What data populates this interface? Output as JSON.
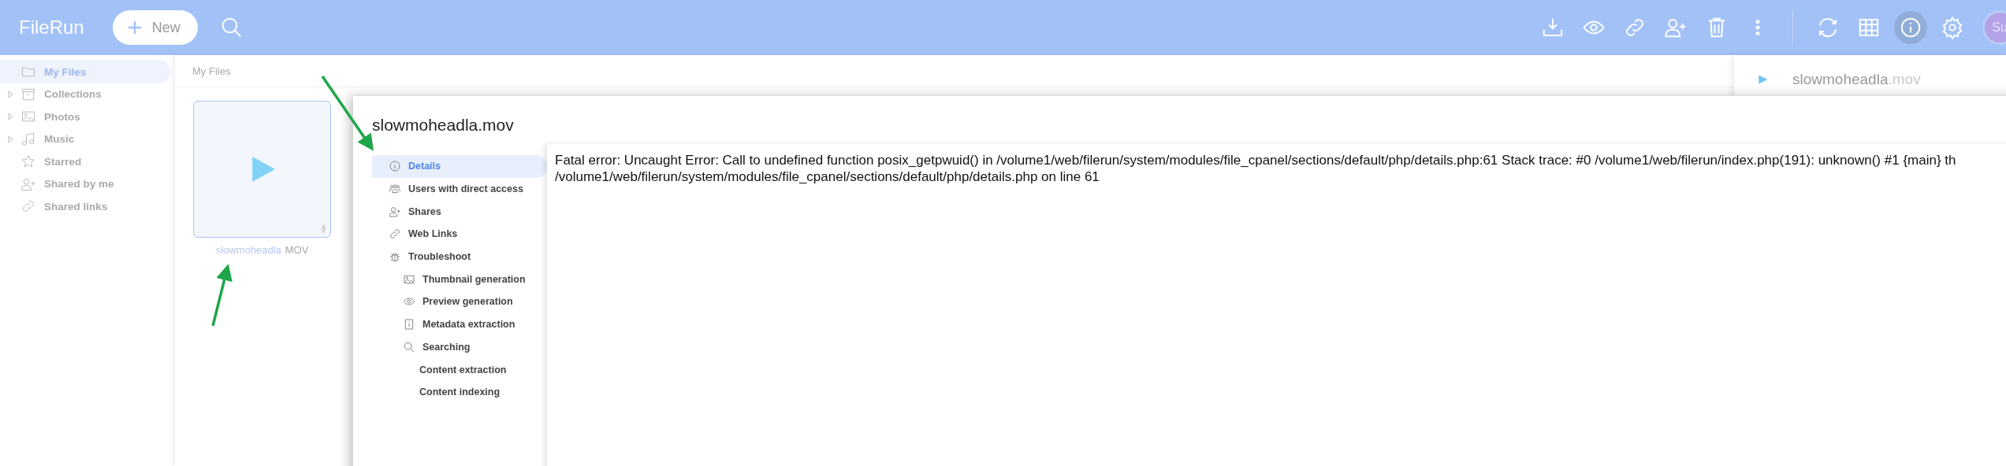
{
  "app": {
    "logo": "FileRun",
    "new_button": "New"
  },
  "toolbar": {
    "info_selected": true,
    "avatar": "Su"
  },
  "sidebar": {
    "items": [
      {
        "label": "My Files",
        "selected": true,
        "has_children": false
      },
      {
        "label": "Collections",
        "selected": false,
        "has_children": true
      },
      {
        "label": "Photos",
        "selected": false,
        "has_children": true
      },
      {
        "label": "Music",
        "selected": false,
        "has_children": true
      },
      {
        "label": "Starred",
        "selected": false,
        "has_children": false
      },
      {
        "label": "Shared by me",
        "selected": false,
        "has_children": false
      },
      {
        "label": "Shared links",
        "selected": false,
        "has_children": false
      }
    ]
  },
  "breadcrumb": "My Files",
  "files": [
    {
      "name": "slowmoheadla",
      "extension": "MOV",
      "selected": true
    }
  ],
  "info_panel": {
    "name": "slowmoheadla",
    "extension": ".mov"
  },
  "dialog": {
    "title": "slowmoheadla.mov",
    "menu": [
      {
        "label": "Details",
        "selected": true
      },
      {
        "label": "Users with direct access",
        "selected": false
      },
      {
        "label": "Shares",
        "selected": false
      },
      {
        "label": "Web Links",
        "selected": false
      },
      {
        "label": "Troubleshoot",
        "selected": false,
        "children": [
          {
            "label": "Thumbnail generation",
            "selected": false
          },
          {
            "label": "Preview generation",
            "selected": false
          },
          {
            "label": "Metadata extraction",
            "selected": false
          },
          {
            "label": "Searching",
            "selected": false,
            "children": [
              {
                "label": "Content extraction",
                "selected": false
              },
              {
                "label": "Content indexing",
                "selected": false
              }
            ]
          }
        ]
      }
    ],
    "error_lines": [
      "Fatal error: Uncaught Error: Call to undefined function posix_getpwuid() in /volume1/web/filerun/system/modules/file_cpanel/sections/default/php/details.php:61 Stack trace: #0 /volume1/web/filerun/index.php(191): unknown() #1 {main} th",
      "/volume1/web/filerun/system/modules/file_cpanel/sections/default/php/details.php on line 61"
    ]
  }
}
